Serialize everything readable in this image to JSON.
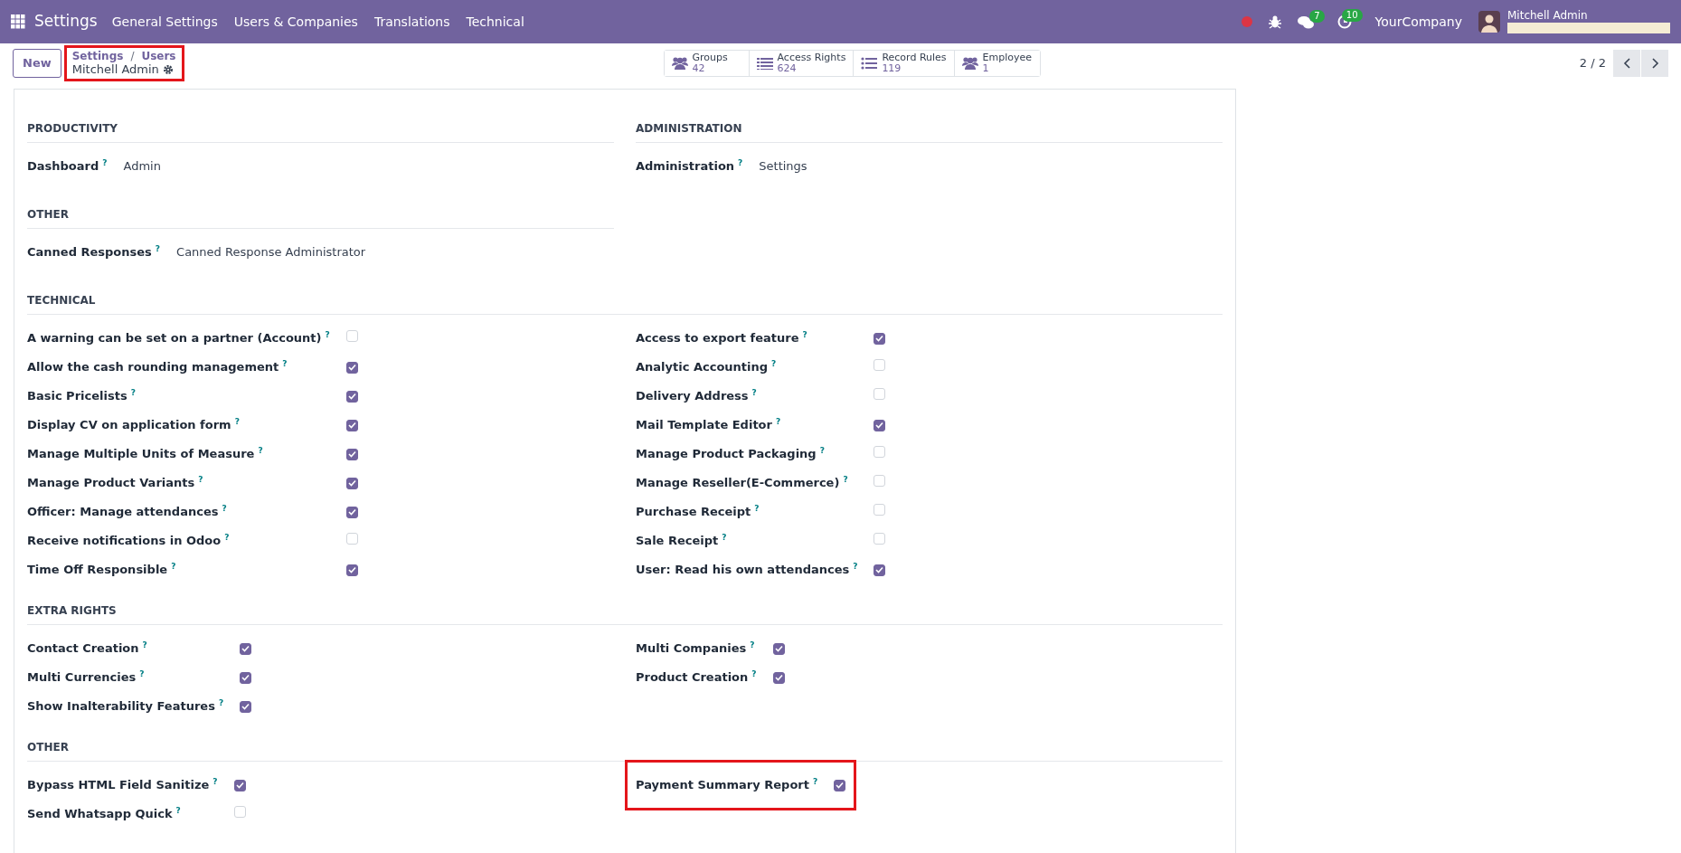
{
  "navbar": {
    "app": "Settings",
    "menus": [
      "General Settings",
      "Users & Companies",
      "Translations",
      "Technical"
    ]
  },
  "systray": {
    "chat_count": "7",
    "activity_count": "10",
    "company": "YourCompany",
    "user": "Mitchell Admin"
  },
  "control_panel": {
    "new_button": "New",
    "breadcrumbs": [
      "Settings",
      "Users"
    ],
    "separator": "/",
    "record": "Mitchell Admin",
    "highlighted": true,
    "stat_buttons": [
      {
        "kind": "group",
        "label": "Groups",
        "value": "42"
      },
      {
        "kind": "list",
        "label": "Access Rights",
        "value": "624"
      },
      {
        "kind": "bullets",
        "label": "Record Rules",
        "value": "119"
      },
      {
        "kind": "group",
        "label": "Employee",
        "value": "1"
      }
    ],
    "pager": "2 / 2"
  },
  "sections": [
    {
      "columns": [
        {
          "title": "PRODUCTIVITY",
          "fields": [
            {
              "kind": "value",
              "label": "Dashboard",
              "help": "?",
              "value": "Admin"
            }
          ]
        },
        {
          "title": "ADMINISTRATION",
          "fields": [
            {
              "kind": "value",
              "label": "Administration",
              "help": "?",
              "value": "Settings"
            }
          ]
        }
      ]
    },
    {
      "columns": [
        {
          "title": "OTHER",
          "fields": [
            {
              "kind": "value",
              "label": "Canned Responses",
              "help": "?",
              "value": "Canned Response Administrator"
            }
          ]
        }
      ]
    },
    {
      "title": "TECHNICAL",
      "columns": [
        {
          "fields": [
            {
              "kind": "checkbox",
              "label": "A warning can be set on a partner (Account)",
              "help": "?",
              "checked": false
            },
            {
              "kind": "checkbox",
              "label": "Allow the cash rounding management",
              "help": "?",
              "checked": true
            },
            {
              "kind": "checkbox",
              "label": "Basic Pricelists",
              "help": "?",
              "checked": true
            },
            {
              "kind": "checkbox",
              "label": "Display CV on application form",
              "help": "?",
              "checked": true
            },
            {
              "kind": "checkbox",
              "label": "Manage Multiple Units of Measure",
              "help": "?",
              "checked": true
            },
            {
              "kind": "checkbox",
              "label": "Manage Product Variants",
              "help": "?",
              "checked": true
            },
            {
              "kind": "checkbox",
              "label": "Officer: Manage attendances",
              "help": "?",
              "checked": true
            },
            {
              "kind": "checkbox",
              "label": "Receive notifications in Odoo",
              "help": "?",
              "checked": false
            },
            {
              "kind": "checkbox",
              "label": "Time Off Responsible",
              "help": "?",
              "checked": true
            }
          ]
        },
        {
          "fields": [
            {
              "kind": "checkbox",
              "label": "Access to export feature",
              "help": "?",
              "checked": true
            },
            {
              "kind": "checkbox",
              "label": "Analytic Accounting",
              "help": "?",
              "checked": false
            },
            {
              "kind": "checkbox",
              "label": "Delivery Address",
              "help": "?",
              "checked": false
            },
            {
              "kind": "checkbox",
              "label": "Mail Template Editor",
              "help": "?",
              "checked": true
            },
            {
              "kind": "checkbox",
              "label": "Manage Product Packaging",
              "help": "?",
              "checked": false
            },
            {
              "kind": "checkbox",
              "label": "Manage Reseller(E-Commerce)",
              "help": "?",
              "checked": false
            },
            {
              "kind": "checkbox",
              "label": "Purchase Receipt",
              "help": "?",
              "checked": false
            },
            {
              "kind": "checkbox",
              "label": "Sale Receipt",
              "help": "?",
              "checked": false
            },
            {
              "kind": "checkbox",
              "label": "User: Read his own attendances",
              "help": "?",
              "checked": true
            }
          ]
        }
      ]
    },
    {
      "title": "EXTRA RIGHTS",
      "columns": [
        {
          "fields": [
            {
              "kind": "checkbox",
              "label": "Contact Creation",
              "help": "?",
              "checked": true
            },
            {
              "kind": "checkbox",
              "label": "Multi Currencies",
              "help": "?",
              "checked": true
            },
            {
              "kind": "checkbox",
              "label": "Show Inalterability Features",
              "help": "?",
              "checked": true
            }
          ]
        },
        {
          "fields": [
            {
              "kind": "checkbox",
              "label": "Multi Companies",
              "help": "?",
              "checked": true
            },
            {
              "kind": "checkbox",
              "label": "Product Creation",
              "help": "?",
              "checked": true
            }
          ]
        }
      ]
    },
    {
      "title": "OTHER",
      "columns": [
        {
          "fields": [
            {
              "kind": "checkbox",
              "label": "Bypass HTML Field Sanitize",
              "help": "?",
              "checked": true
            },
            {
              "kind": "checkbox",
              "label": "Send Whatsapp Quick",
              "help": "?",
              "checked": false
            }
          ]
        },
        {
          "fields": [
            {
              "kind": "checkbox",
              "label": "Payment Summary Report",
              "help": "?",
              "checked": true,
              "highlighted": true
            }
          ]
        }
      ]
    }
  ]
}
